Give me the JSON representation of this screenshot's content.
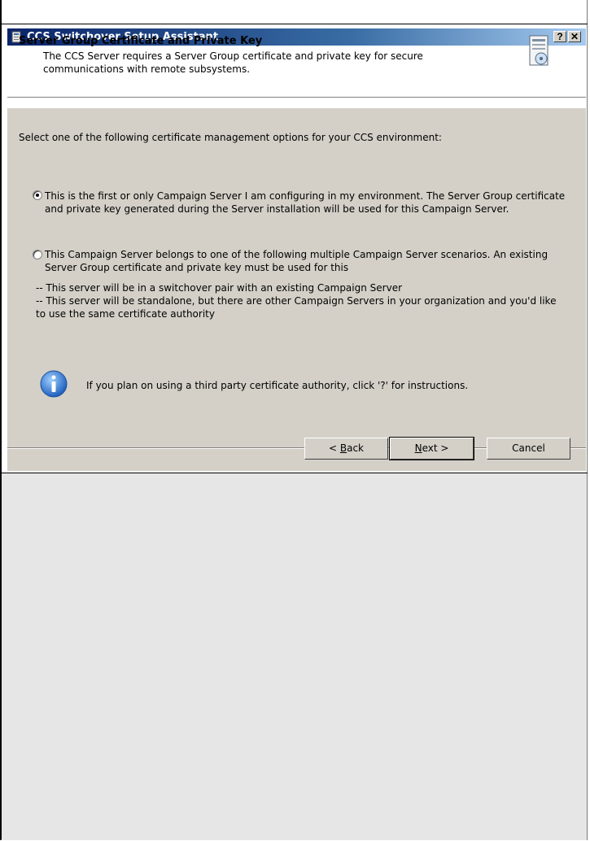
{
  "window": {
    "title": "CCS Switchover Setup Assistant",
    "help_button": "?",
    "close_button": "✕"
  },
  "header": {
    "title": "Server Group Certificate and Private Key",
    "subtitle": "The CCS Server requires a Server Group certificate and private key for secure communications with remote subsystems."
  },
  "body": {
    "prompt": "Select one of the following certificate management options for your CCS environment:",
    "options": [
      {
        "label": "This is the first or only Campaign Server I am configuring in my environment. The Server Group certificate and private key generated during the Server installation will be used for this Campaign Server.",
        "selected": true
      },
      {
        "label": "This Campaign Server belongs to one of the following multiple Campaign Server scenarios. An existing Server Group certificate and private key must be used for this",
        "selected": false
      }
    ],
    "notes": [
      "-- This server will be in a switchover pair with an existing Campaign Server",
      "-- This server will be standalone, but there are other Campaign Servers in your organization and you'd like to use the same certificate authority"
    ],
    "info": "If you plan on using a third party certificate authority, click '?' for instructions."
  },
  "buttons": {
    "back_rest": "ack",
    "back_prefix": "< ",
    "back_key": "B",
    "next_key": "N",
    "next_rest": "ext >",
    "cancel": "Cancel"
  },
  "colors": {
    "titlebar_start": "#0a246a",
    "dialog_bg": "#d4d0c8",
    "panel_bg": "#e6e6e6"
  }
}
